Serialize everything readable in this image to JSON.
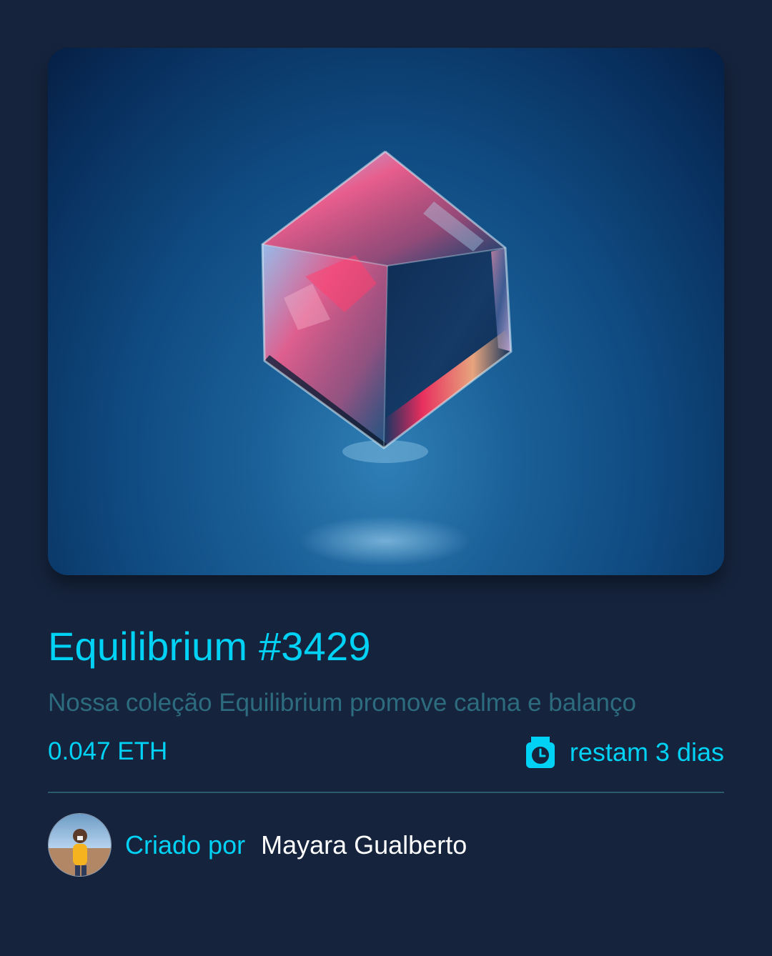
{
  "nft": {
    "image_alt": "Equilibrium cube image",
    "title": "Equilibrium #3429",
    "description": "Nossa coleção Equilibrium promove calma e balanço",
    "price": "0.047 ETH",
    "time_icon": "clock-icon",
    "time_remaining": "restam 3 dias"
  },
  "creator": {
    "avatar_icon": "avatar",
    "label": "Criado por",
    "name": "Mayara Gualberto"
  },
  "colors": {
    "background": "#15233c",
    "accent": "#00d2f5",
    "muted": "#2d6b7e",
    "divider": "#2b5a6e",
    "text": "#ffffff"
  }
}
